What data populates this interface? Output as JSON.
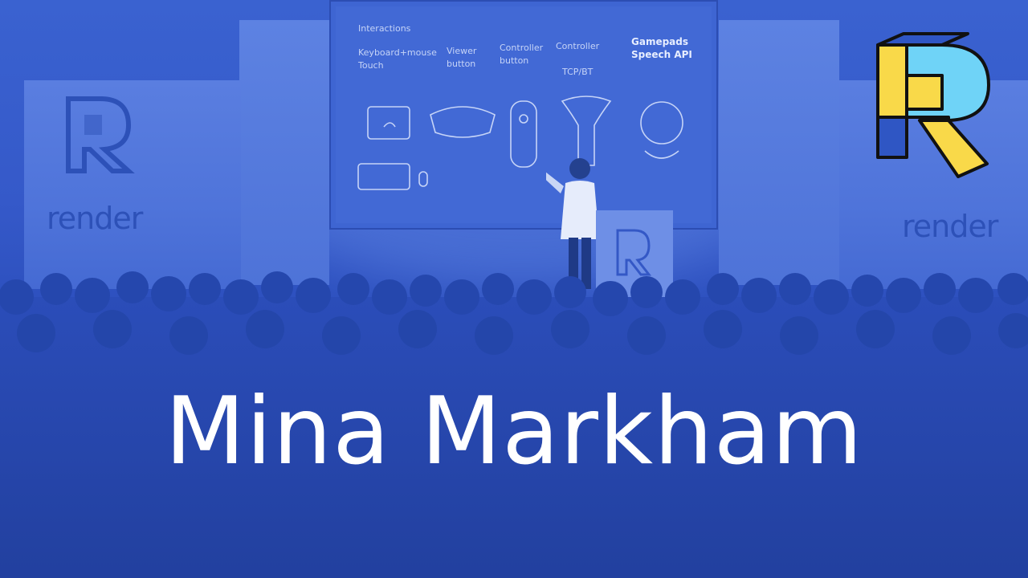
{
  "title": "Mina Markham",
  "banners": {
    "left_word": "render",
    "right_word": "render"
  },
  "slide": {
    "heading": "Interactions",
    "col1": "Keyboard+mouse\nTouch",
    "col2": "Viewer\nbutton",
    "col3": "Controller\nbutton",
    "col4_a": "Controller",
    "col4_b": "TCP/BT",
    "col5": "Gamepads\nSpeech API"
  },
  "colors": {
    "overlay": "#2f56c4",
    "title": "#ffffff",
    "logo_yellow": "#f9d949",
    "logo_cyan": "#6fd3f7",
    "logo_blue": "#2f56c4",
    "logo_outline": "#111111"
  },
  "icons": {
    "logo": "render-logo-icon",
    "banner_logo": "render-logo-icon",
    "podium_logo": "render-logo-icon"
  }
}
